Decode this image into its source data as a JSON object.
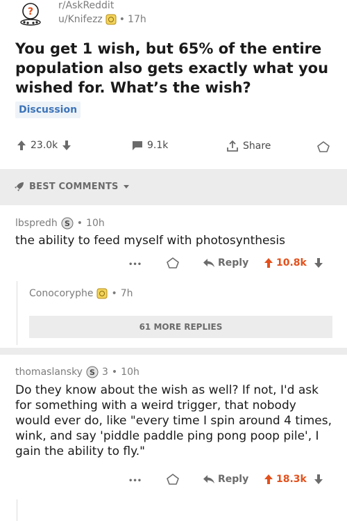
{
  "post": {
    "subreddit": "r/AskReddit",
    "author": "u/Knifezz",
    "age": "17h",
    "separator": "•",
    "title": "You get 1 wish, but 65% of the entire population also gets exactly what you wished for. What’s the wish?",
    "flair": "Discussion",
    "upvotes": "23.0k",
    "comments": "9.1k",
    "share_label": "Share"
  },
  "section": {
    "label": "BEST COMMENTS"
  },
  "comments": [
    {
      "author": "lbspredh",
      "age": "10h",
      "body": "the ability to feed myself with photosynthesis",
      "ellipsis": "•••",
      "reply_label": "Reply",
      "score": "10.8k"
    },
    {
      "author": "Conocoryphe",
      "age": "7h",
      "more_replies": "61 MORE REPLIES"
    },
    {
      "author": "thomaslansky",
      "coin_count": "3",
      "age": "10h",
      "body": "Do they know about the wish as well? If not, I'd ask for something with a weird trigger, that nobody would ever do, like \"every time I spin around 4 times, wink, and say 'piddle paddle ping pong poop pile', I gain the ability to fly.\"",
      "ellipsis": "•••",
      "reply_label": "Reply",
      "score": "18.3k"
    }
  ],
  "colors": {
    "upvote": "#e4501b",
    "flair_bg": "#eef3f8",
    "flair_text": "#3d74b8",
    "gold": "#e8b923"
  }
}
